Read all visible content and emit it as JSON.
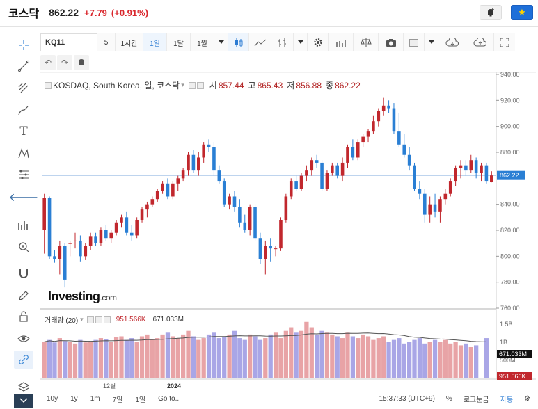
{
  "header": {
    "name": "코스닥",
    "price": "862.22",
    "change": "+7.79",
    "change_pct": "(+0.91%)"
  },
  "toolbar": {
    "symbol": "KQ11",
    "intervals": [
      "5",
      "1시간",
      "1일",
      "1달",
      "1월"
    ],
    "active_interval": "1일"
  },
  "legend": {
    "title": "KOSDAQ, South Korea, 일, 코스닥",
    "o_label": "시",
    "o": "857.44",
    "h_label": "고",
    "h": "865.43",
    "l_label": "저",
    "l": "856.88",
    "c_label": "종",
    "c": "862.22"
  },
  "volume_legend": {
    "title": "거래량 (20)",
    "v1": "951.566K",
    "v2": "671.033M"
  },
  "price_axis": {
    "ticks": [
      "940.00",
      "920.00",
      "900.00",
      "880.00",
      "862.22",
      "840.00",
      "820.00",
      "800.00",
      "780.00",
      "760.00"
    ]
  },
  "volume_axis": {
    "ticks": [
      "1.5B",
      "1B",
      "500M"
    ],
    "tags": [
      "671.033M",
      "951.566K"
    ]
  },
  "time_axis": {
    "labels": [
      "12월",
      "2024"
    ]
  },
  "watermark": "Investing.com",
  "bottom_bar": {
    "ranges": [
      "10y",
      "1y",
      "1m",
      "7일",
      "1일",
      "Go to..."
    ],
    "time": "15:37:33 (UTC+9)",
    "pct": "%",
    "log": "로그눈금",
    "auto": "자동"
  },
  "colors": {
    "up": "#c1272d",
    "down": "#2a7fd4",
    "vol_up": "#e8a3a6",
    "vol_down": "#a9a6e6",
    "accent": "#1e6fd9"
  },
  "chart_data": {
    "type": "candlestick",
    "price_ylim": [
      760,
      940
    ],
    "last_price": 862.22,
    "ohlc": [
      [
        820,
        848,
        802,
        845
      ],
      [
        845,
        846,
        798,
        800
      ],
      [
        800,
        805,
        795,
        798
      ],
      [
        798,
        812,
        786,
        808
      ],
      [
        808,
        810,
        776,
        782
      ],
      [
        810,
        812,
        800,
        810
      ],
      [
        812,
        818,
        806,
        812
      ],
      [
        812,
        816,
        796,
        800
      ],
      [
        800,
        810,
        797,
        808
      ],
      [
        808,
        818,
        805,
        815
      ],
      [
        815,
        818,
        808,
        810
      ],
      [
        810,
        822,
        808,
        820
      ],
      [
        820,
        824,
        812,
        814
      ],
      [
        814,
        820,
        810,
        818
      ],
      [
        818,
        828,
        816,
        826
      ],
      [
        826,
        832,
        822,
        830
      ],
      [
        830,
        834,
        816,
        818
      ],
      [
        818,
        824,
        812,
        816
      ],
      [
        816,
        830,
        814,
        828
      ],
      [
        828,
        838,
        826,
        836
      ],
      [
        836,
        842,
        830,
        840
      ],
      [
        840,
        846,
        838,
        844
      ],
      [
        844,
        852,
        842,
        850
      ],
      [
        850,
        858,
        848,
        856
      ],
      [
        856,
        860,
        844,
        846
      ],
      [
        846,
        858,
        844,
        856
      ],
      [
        856,
        862,
        850,
        860
      ],
      [
        860,
        868,
        858,
        866
      ],
      [
        866,
        880,
        862,
        878
      ],
      [
        878,
        882,
        864,
        866
      ],
      [
        866,
        880,
        862,
        876
      ],
      [
        876,
        888,
        872,
        886
      ],
      [
        886,
        890,
        880,
        884
      ],
      [
        884,
        888,
        862,
        866
      ],
      [
        866,
        870,
        856,
        858
      ],
      [
        858,
        860,
        838,
        840
      ],
      [
        840,
        848,
        836,
        846
      ],
      [
        846,
        850,
        834,
        838
      ],
      [
        838,
        844,
        822,
        826
      ],
      [
        826,
        832,
        818,
        820
      ],
      [
        820,
        840,
        816,
        838
      ],
      [
        838,
        840,
        812,
        814
      ],
      [
        814,
        818,
        794,
        798
      ],
      [
        798,
        812,
        786,
        808
      ],
      [
        808,
        814,
        796,
        806
      ],
      [
        806,
        808,
        800,
        806
      ],
      [
        806,
        830,
        804,
        828
      ],
      [
        828,
        848,
        826,
        846
      ],
      [
        846,
        860,
        844,
        858
      ],
      [
        858,
        862,
        850,
        852
      ],
      [
        852,
        864,
        850,
        862
      ],
      [
        862,
        870,
        858,
        866
      ],
      [
        866,
        876,
        862,
        874
      ],
      [
        874,
        878,
        868,
        872
      ],
      [
        872,
        874,
        850,
        852
      ],
      [
        852,
        866,
        850,
        864
      ],
      [
        864,
        872,
        862,
        870
      ],
      [
        870,
        872,
        860,
        862
      ],
      [
        862,
        876,
        858,
        872
      ],
      [
        872,
        886,
        868,
        884
      ],
      [
        884,
        890,
        874,
        876
      ],
      [
        876,
        890,
        874,
        888
      ],
      [
        888,
        894,
        884,
        892
      ],
      [
        892,
        898,
        888,
        896
      ],
      [
        896,
        908,
        894,
        904
      ],
      [
        904,
        914,
        900,
        912
      ],
      [
        912,
        922,
        908,
        916
      ],
      [
        916,
        920,
        910,
        914
      ],
      [
        914,
        918,
        894,
        896
      ],
      [
        896,
        910,
        884,
        886
      ],
      [
        886,
        894,
        876,
        878
      ],
      [
        878,
        884,
        866,
        870
      ],
      [
        870,
        872,
        850,
        852
      ],
      [
        852,
        858,
        844,
        848
      ],
      [
        848,
        852,
        826,
        832
      ],
      [
        832,
        846,
        826,
        840
      ],
      [
        840,
        848,
        830,
        834
      ],
      [
        834,
        846,
        826,
        844
      ],
      [
        844,
        852,
        840,
        848
      ],
      [
        848,
        860,
        846,
        858
      ],
      [
        858,
        870,
        854,
        868
      ],
      [
        868,
        874,
        860,
        870
      ],
      [
        870,
        874,
        862,
        866
      ],
      [
        866,
        878,
        864,
        874
      ],
      [
        874,
        876,
        860,
        864
      ],
      [
        864,
        872,
        858,
        870
      ],
      [
        870,
        872,
        856,
        858
      ],
      [
        857.44,
        865.43,
        856.88,
        862.22
      ]
    ],
    "volume_ylim": [
      0,
      1700000000
    ],
    "volume": [
      1000000000,
      1050000000,
      980000000,
      1100000000,
      1020000000,
      1000000000,
      950000000,
      1050000000,
      980000000,
      1000000000,
      1050000000,
      1100000000,
      1080000000,
      1000000000,
      1120000000,
      1150000000,
      1050000000,
      1100000000,
      1000000000,
      1150000000,
      1200000000,
      1080000000,
      1100000000,
      1200000000,
      1250000000,
      1150000000,
      1100000000,
      1200000000,
      1300000000,
      1150000000,
      1050000000,
      1100000000,
      1200000000,
      1250000000,
      1100000000,
      1150000000,
      1200000000,
      1300000000,
      1100000000,
      1050000000,
      1200000000,
      1150000000,
      1050000000,
      1100000000,
      1200000000,
      1250000000,
      1100000000,
      1300000000,
      1400000000,
      1250000000,
      1300000000,
      1550000000,
      1400000000,
      1200000000,
      1300000000,
      1250000000,
      1200000000,
      1150000000,
      1100000000,
      1250000000,
      1150000000,
      1100000000,
      1200000000,
      1150000000,
      1050000000,
      1100000000,
      1150000000,
      1000000000,
      1050000000,
      1100000000,
      950000000,
      1000000000,
      1050000000,
      1100000000,
      950000000,
      1000000000,
      1050000000,
      1000000000,
      1050000000,
      950000000,
      1000000000,
      900000000,
      950000000,
      850000000,
      900000000,
      0,
      1100000000,
      951566
    ]
  }
}
